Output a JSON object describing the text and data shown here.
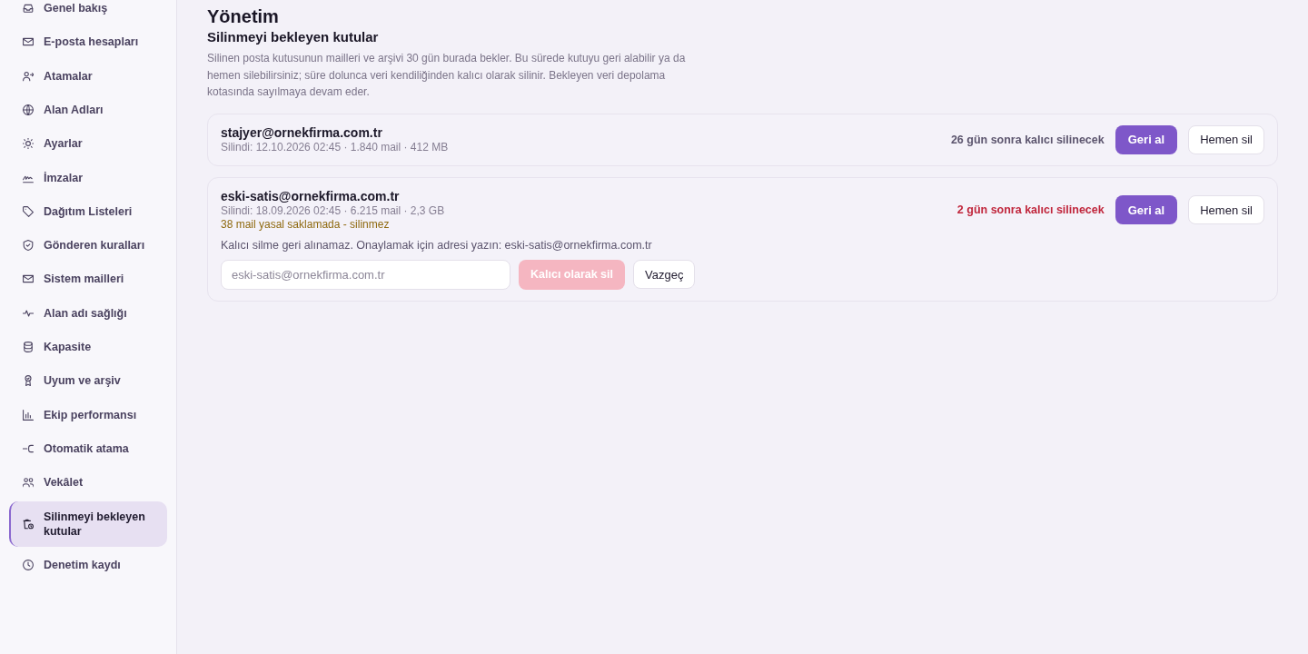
{
  "sidebar": {
    "items": [
      {
        "label": "Genel bakış",
        "selected": false
      },
      {
        "label": "E-posta hesapları",
        "selected": false
      },
      {
        "label": "Atamalar",
        "selected": false
      },
      {
        "label": "Alan Adları",
        "selected": false
      },
      {
        "label": "Ayarlar",
        "selected": false
      },
      {
        "label": "İmzalar",
        "selected": false
      },
      {
        "label": "Dağıtım Listeleri",
        "selected": false
      },
      {
        "label": "Gönderen kuralları",
        "selected": false
      },
      {
        "label": "Sistem mailleri",
        "selected": false
      },
      {
        "label": "Alan adı sağlığı",
        "selected": false
      },
      {
        "label": "Kapasite",
        "selected": false
      },
      {
        "label": "Uyum ve arşiv",
        "selected": false
      },
      {
        "label": "Ekip performansı",
        "selected": false
      },
      {
        "label": "Otomatik atama",
        "selected": false
      },
      {
        "label": "Vekâlet",
        "selected": false
      },
      {
        "label": "Silinmeyi bekleyen kutular",
        "selected": true
      },
      {
        "label": "Denetim kaydı",
        "selected": false
      }
    ]
  },
  "page": {
    "section": "Yönetim",
    "title": "Silinmeyi bekleyen kutular",
    "description": "Silinen posta kutusunun mailleri ve arşivi 30 gün burada bekler. Bu sürede kutuyu geri alabilir ya da hemen silebilirsiniz; süre dolunca veri kendiliğinden kalıcı olarak silinir. Bekleyen veri depolama kotasında sayılmaya devam eder."
  },
  "mailboxes": [
    {
      "email": "stajyer@ornekfirma.com.tr",
      "details": "Silindi: 12.10.2026 02:45 · 1.840 mail · 412 MB",
      "countdown": "26 gün sonra kalıcı silinecek",
      "urgent": false,
      "restore_button": "Geri al",
      "delete_button": "Hemen sil"
    },
    {
      "email": "eski-satis@ornekfirma.com.tr",
      "details": "Silindi: 18.09.2026 02:45 · 6.215 mail · 2,3 GB",
      "legal_hold": "38 mail yasal saklamada - silinmez",
      "countdown": "2 gün sonra kalıcı silinecek",
      "urgent": true,
      "restore_button": "Geri al",
      "delete_button": "Hemen sil",
      "confirm": {
        "prompt": "Kalıcı silme geri alınamaz. Onaylamak için adresi yazın: eski-satis@ornekfirma.com.tr",
        "placeholder": "eski-satis@ornekfirma.com.tr",
        "confirm_button": "Kalıcı olarak sil",
        "disabled": true,
        "cancel_button": "Vazgeç"
      }
    }
  ]
}
